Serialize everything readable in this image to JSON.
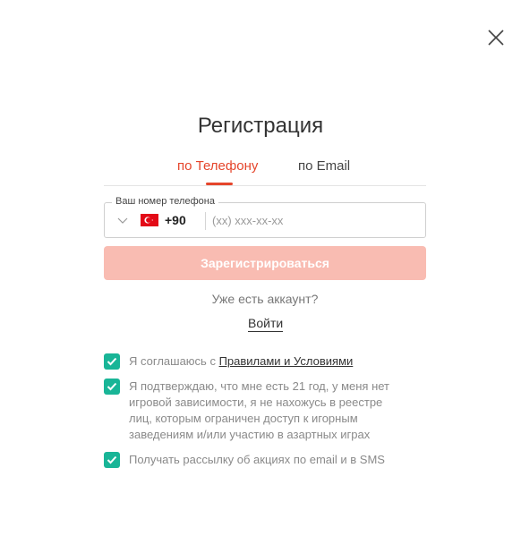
{
  "dialog": {
    "title": "Регистрация",
    "close_icon": "close-icon"
  },
  "tabs": [
    {
      "label": "по Телефону",
      "active": true
    },
    {
      "label": "по Email",
      "active": false
    }
  ],
  "phone_field": {
    "legend": "Ваш номер телефона",
    "country_flag": "turkey-flag-icon",
    "dial_code": "+90",
    "placeholder": "(xx) xxx-xx-xx",
    "value": ""
  },
  "register_button": {
    "label": "Зарегистрироваться"
  },
  "login_prompt": {
    "text": "Уже есть аккаунт?",
    "link_label": "Войти"
  },
  "agreements": [
    {
      "checked": true,
      "text_before": "Я соглашаюсь с ",
      "link": "Правилами и Условиями"
    },
    {
      "checked": true,
      "text_lines": [
        "Я подтверждаю, что мне есть 21 год, у меня нет",
        "игровой зависимости, я не нахожусь в реестре",
        "лиц, которым ограничен доступ к игорным",
        "заведениям и/или участию в азартных играх"
      ]
    },
    {
      "checked": true,
      "text": "Получать рассылку об акциях по email и в SMS"
    }
  ],
  "colors": {
    "accent": "#e5452b",
    "button_disabled": "#f9bcb2",
    "checkbox": "#19b597"
  }
}
